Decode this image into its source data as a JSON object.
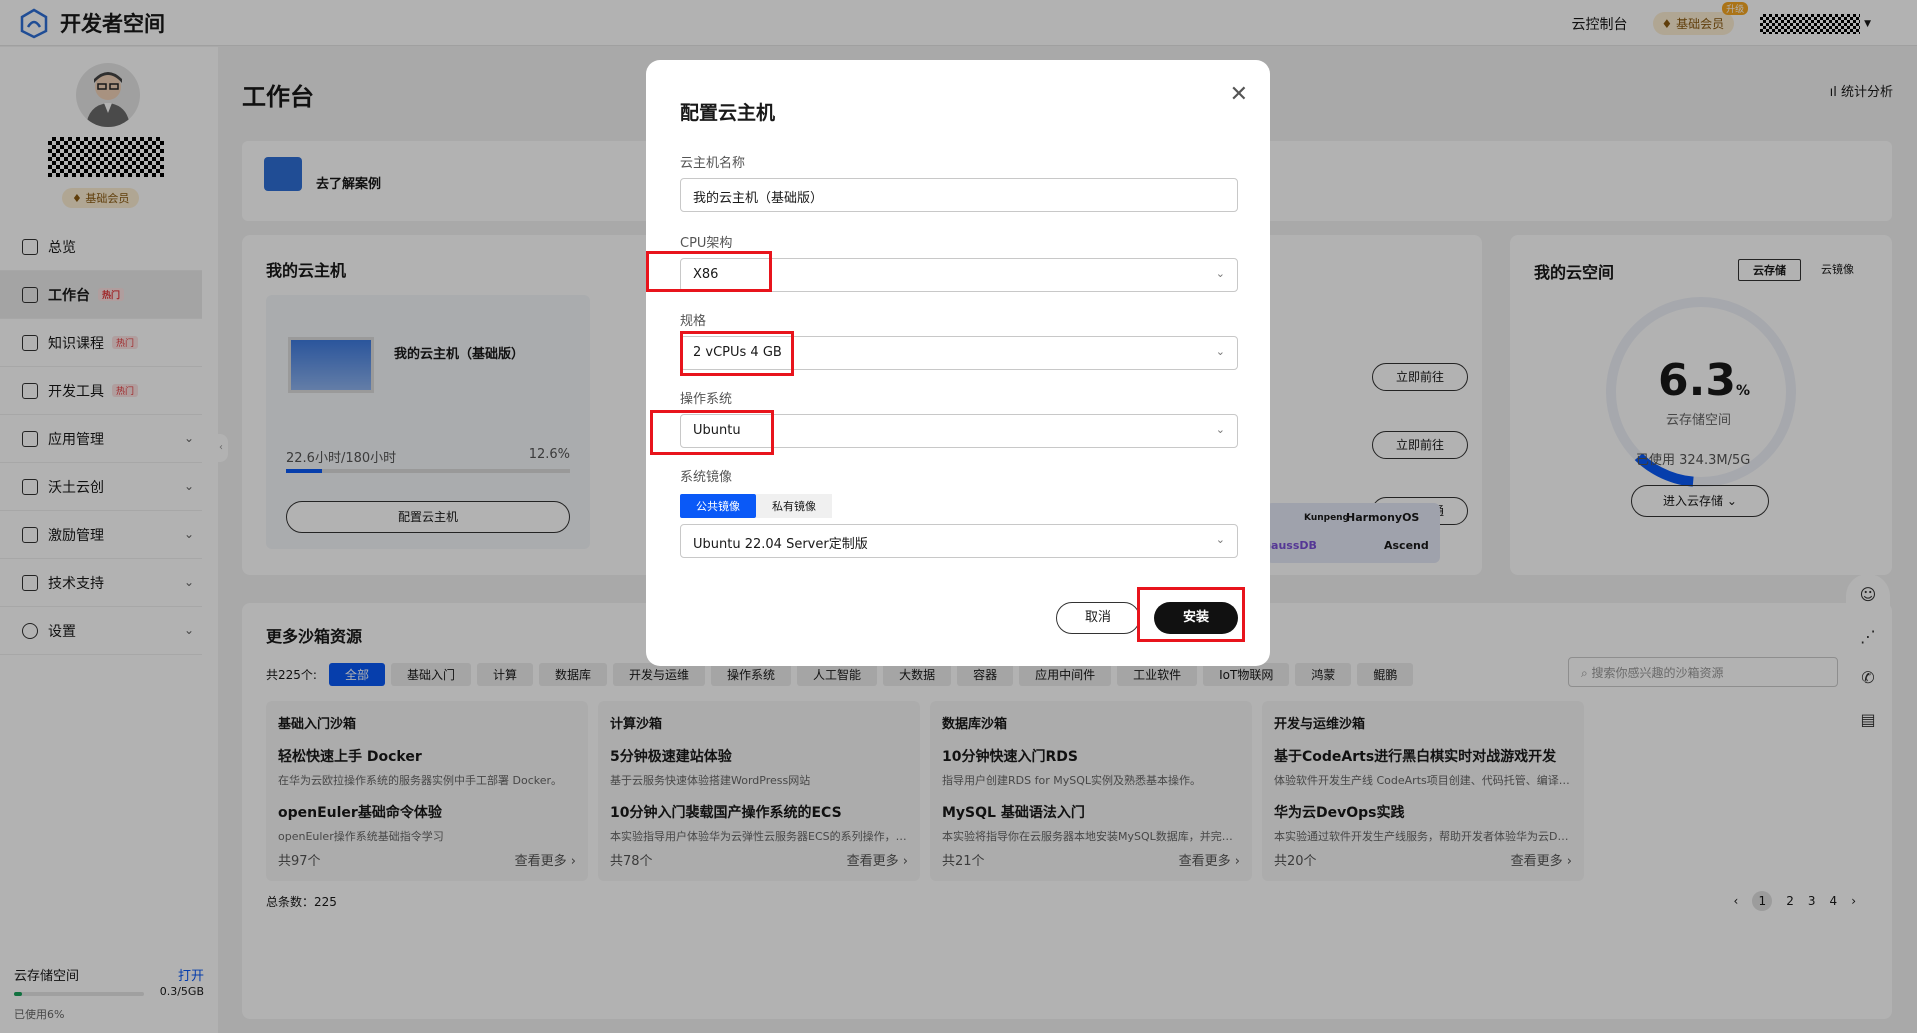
{
  "topbar": {
    "title": "开发者空间",
    "console": "云控制台",
    "member": "基础会员",
    "upgrade": "升级"
  },
  "sidebar": {
    "badge": "基础会员",
    "items": [
      {
        "label": "总览",
        "hot": ""
      },
      {
        "label": "工作台",
        "hot": "热门"
      },
      {
        "label": "知识课程",
        "hot": "热门"
      },
      {
        "label": "开发工具",
        "hot": "热门"
      },
      {
        "label": "应用管理",
        "hot": ""
      },
      {
        "label": "沃土云创",
        "hot": ""
      },
      {
        "label": "激励管理",
        "hot": ""
      },
      {
        "label": "技术支持",
        "hot": ""
      },
      {
        "label": "设置",
        "hot": ""
      }
    ],
    "storage": {
      "title": "云存储空间",
      "open": "打开",
      "size": "0.3/5GB",
      "used": "已使用6%",
      "used_fraction": 0.06
    }
  },
  "main": {
    "title": "工作台",
    "stats": "统计分析",
    "banner": "去了解案例",
    "my_vm": {
      "title": "我的云主机",
      "name": "我的云主机（基础版）",
      "usage": "22.6小时/180小时",
      "pct": "12.6%",
      "used_fraction": 0.126,
      "button": "配置云主机"
    },
    "actions": [
      "立即前往",
      "立即前往",
      "一键开通"
    ],
    "logos": [
      "Kunpeng",
      "HarmonyOS",
      "GaussDB",
      "Ascend"
    ],
    "space": {
      "title": "我的云空间",
      "tabs": [
        "云存储",
        "云镜像"
      ],
      "pct": "6.3",
      "unit": "%",
      "used_fraction": 0.063,
      "label": "云存储空间",
      "used": "已使用    324.3M/5G",
      "enter": "进入云存储"
    },
    "sandbox": {
      "title": "更多沙箱资源",
      "count": "共225个:",
      "chips": [
        "全部",
        "基础入门",
        "计算",
        "数据库",
        "开发与运维",
        "操作系统",
        "人工智能",
        "大数据",
        "容器",
        "应用中间件",
        "工业软件",
        "IoT物联网",
        "鸿蒙",
        "鲲鹏"
      ],
      "search": "搜索你感兴趣的沙箱资源",
      "cards": [
        {
          "head": "基础入门沙箱",
          "t1": "轻松快速上手 Docker",
          "d1": "在华为云欧拉操作系统的服务器实例中手工部署 Docker。",
          "t2": "openEuler基础命令体验",
          "d2": "openEuler操作系统基础指令学习",
          "total": "共97个",
          "more": "查看更多"
        },
        {
          "head": "计算沙箱",
          "t1": "5分钟极速建站体验",
          "d1": "基于云服务快速体验搭建WordPress网站",
          "t2": "10分钟入门裴载国产操作系统的ECS",
          "d2": "本实验指导用户体验华为云弹性云服务器ECS的系列操作，快速掌...",
          "total": "共78个",
          "more": "查看更多"
        },
        {
          "head": "数据库沙箱",
          "t1": "10分钟快速入门RDS",
          "d1": "指导用户创建RDS for MySQL实例及熟悉基本操作。",
          "t2": "MySQL 基础语法入门",
          "d2": "本实验将指导你在云服务器本地安装MySQL数据库，并完成数据...",
          "total": "共21个",
          "more": "查看更多"
        },
        {
          "head": "开发与运维沙箱",
          "t1": "基于CodeArts进行黑白棋实时对战游戏开发",
          "d1": "体验软件开发生产线 CodeArts项目创建、代码托管、编译构建、...",
          "t2": "华为云DevOps实践",
          "d2": "本实验通过软件开发生产线服务，帮助开发者体验华为云DevOps...",
          "total": "共20个",
          "more": "查看更多"
        }
      ],
      "total": "总条数：225",
      "pages": [
        "1",
        "2",
        "3",
        "4"
      ]
    }
  },
  "modal": {
    "title": "配置云主机",
    "name_label": "云主机名称",
    "name_value": "我的云主机（基础版）",
    "cpu_label": "CPU架构",
    "cpu_value": "X86",
    "spec_label": "规格",
    "spec_value": "2 vCPUs 4 GB",
    "os_label": "操作系统",
    "os_value": "Ubuntu",
    "image_label": "系统镜像",
    "image_tabs": [
      "公共镜像",
      "私有镜像"
    ],
    "image_value": "Ubuntu 22.04 Server定制版",
    "cancel": "取消",
    "install": "安装"
  }
}
